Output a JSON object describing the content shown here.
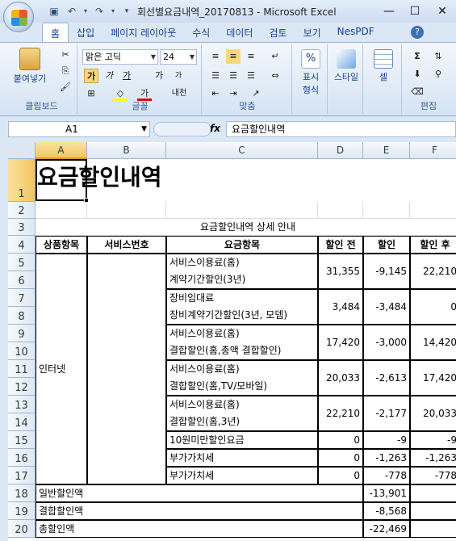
{
  "window": {
    "title": "회선별요금내역_20170813 - Microsoft Excel"
  },
  "ribbon_tabs": [
    "홈",
    "삽입",
    "페이지 레이아웃",
    "수식",
    "데이터",
    "검토",
    "보기",
    "NesPDF"
  ],
  "ribbon": {
    "clipboard": {
      "paste": "붙여넣기",
      "label": "클립보드"
    },
    "font": {
      "name": "맑은 고딕",
      "size": "24",
      "bold": "가",
      "italic": "가",
      "underline": "가",
      "grow": "가",
      "shrink": "가",
      "color": "가",
      "phonetic": "내천",
      "label": "글꼴"
    },
    "align": {
      "label": "맞춤"
    },
    "number": {
      "percent": "%",
      "label1": "표시",
      "label2": "형식"
    },
    "styles": {
      "label": "스타일"
    },
    "cells": {
      "label": "셀"
    },
    "editing": {
      "label": "편집"
    }
  },
  "formula_bar": {
    "name_box": "A1",
    "fx": "fx",
    "content": "요금할인내역"
  },
  "columns": [
    "A",
    "B",
    "C",
    "D",
    "E",
    "F"
  ],
  "rows": [
    "1",
    "2",
    "3",
    "4",
    "5",
    "6",
    "7",
    "8",
    "9",
    "10",
    "11",
    "12",
    "13",
    "14",
    "15",
    "16",
    "17",
    "18",
    "19",
    "20"
  ],
  "sheet": {
    "title": "요금할인내역",
    "subtitle": "요금할인내역 상세 안내",
    "headers": [
      "상품항목",
      "서비스번호",
      "요금항목",
      "할인 전",
      "할인",
      "할인 후"
    ],
    "product": "인터넷",
    "items": [
      {
        "l1": "서비스이용료(홈)",
        "l2": "계약기간할인(3년)",
        "before": "31,355",
        "disc": "-9,145",
        "after": "22,210"
      },
      {
        "l1": "장비임대료",
        "l2": "장비계약기간할인(3년, 모뎀)",
        "before": "3,484",
        "disc": "-3,484",
        "after": "0"
      },
      {
        "l1": "서비스이용료(홈)",
        "l2": "결합할인(홈,총액 결합할인)",
        "before": "17,420",
        "disc": "-3,000",
        "after": "14,420"
      },
      {
        "l1": "서비스이용료(홈)",
        "l2": "결합할인(홈,TV/모바일)",
        "before": "20,033",
        "disc": "-2,613",
        "after": "17,420"
      },
      {
        "l1": "서비스이용료(홈)",
        "l2": "결합할인(홈,3년)",
        "before": "22,210",
        "disc": "-2,177",
        "after": "20,033"
      }
    ],
    "singles": [
      {
        "name": "10원미만할인요금",
        "before": "0",
        "disc": "-9",
        "after": "-9"
      },
      {
        "name": "부가가치세",
        "before": "0",
        "disc": "-1,263",
        "after": "-1,263"
      },
      {
        "name": "부가가치세",
        "before": "0",
        "disc": "-778",
        "after": "-778"
      }
    ],
    "totals": [
      {
        "label": "일반할인액",
        "value": "-13,901"
      },
      {
        "label": "결합할인액",
        "value": "-8,568"
      },
      {
        "label": "총할인액",
        "value": "-22,469"
      }
    ]
  }
}
